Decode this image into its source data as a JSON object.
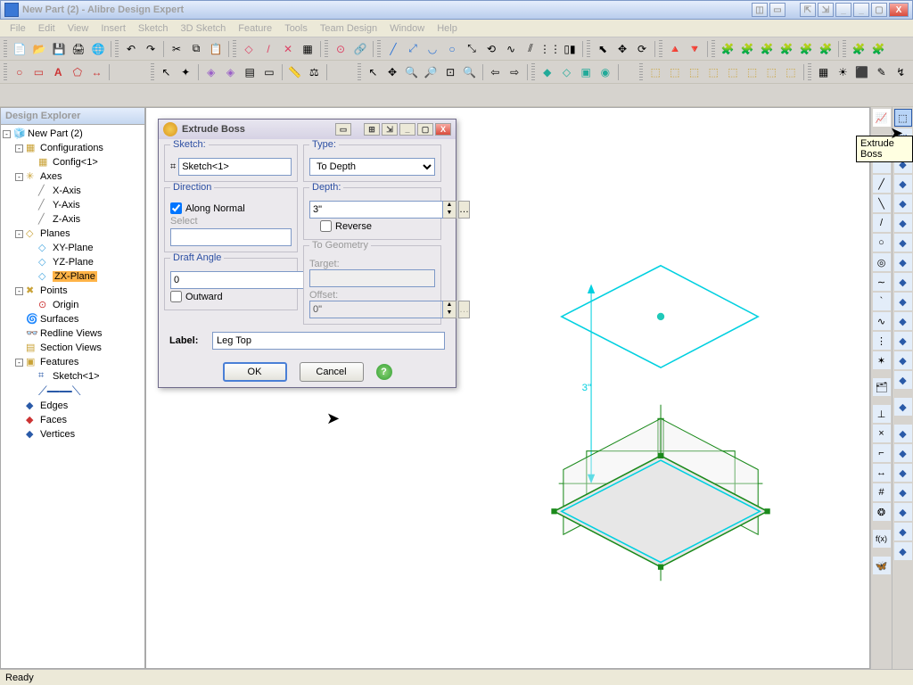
{
  "window": {
    "title": "New Part (2) - Alibre Design Expert"
  },
  "menu": [
    "File",
    "Edit",
    "View",
    "Insert",
    "Sketch",
    "3D Sketch",
    "Feature",
    "Tools",
    "Team Design",
    "Window",
    "Help"
  ],
  "explorer": {
    "title": "Design Explorer",
    "tree": [
      {
        "d": 0,
        "t": "-",
        "i": "part",
        "l": "New Part (2)"
      },
      {
        "d": 1,
        "t": "-",
        "i": "cfg",
        "l": "Configurations"
      },
      {
        "d": 2,
        "t": "",
        "i": "cfg",
        "l": "Config<1>"
      },
      {
        "d": 1,
        "t": "-",
        "i": "axes",
        "l": "Axes"
      },
      {
        "d": 2,
        "t": "",
        "i": "axis",
        "l": "X-Axis"
      },
      {
        "d": 2,
        "t": "",
        "i": "axis",
        "l": "Y-Axis"
      },
      {
        "d": 2,
        "t": "",
        "i": "axis",
        "l": "Z-Axis"
      },
      {
        "d": 1,
        "t": "-",
        "i": "planes",
        "l": "Planes"
      },
      {
        "d": 2,
        "t": "",
        "i": "plane",
        "l": "XY-Plane"
      },
      {
        "d": 2,
        "t": "",
        "i": "plane",
        "l": "YZ-Plane"
      },
      {
        "d": 2,
        "t": "",
        "i": "plane",
        "l": "ZX-Plane",
        "sel": true
      },
      {
        "d": 1,
        "t": "-",
        "i": "points",
        "l": "Points"
      },
      {
        "d": 2,
        "t": "",
        "i": "point",
        "l": "Origin"
      },
      {
        "d": 1,
        "t": "",
        "i": "surf",
        "l": "Surfaces"
      },
      {
        "d": 1,
        "t": "",
        "i": "rl",
        "l": "Redline Views"
      },
      {
        "d": 1,
        "t": "",
        "i": "sv",
        "l": "Section Views"
      },
      {
        "d": 1,
        "t": "-",
        "i": "feat",
        "l": "Features"
      },
      {
        "d": 2,
        "t": "",
        "i": "sketch",
        "l": "Sketch<1>"
      },
      {
        "d": 1,
        "t": "",
        "i": "edges",
        "l": "Edges"
      },
      {
        "d": 1,
        "t": "",
        "i": "faces",
        "l": "Faces"
      },
      {
        "d": 1,
        "t": "",
        "i": "verts",
        "l": "Vertices"
      }
    ]
  },
  "dialog": {
    "title": "Extrude Boss",
    "sketch_group": "Sketch:",
    "sketch_value": "Sketch<1>",
    "direction_group": "Direction",
    "along_normal": "Along Normal",
    "select_label": "Select",
    "draft_group": "Draft Angle",
    "draft_value": "0",
    "outward": "Outward",
    "type_group": "Type:",
    "type_value": "To Depth",
    "depth_group": "Depth:",
    "depth_value": "3\"",
    "reverse": "Reverse",
    "togeo_group": "To Geometry",
    "target_label": "Target:",
    "offset_label": "Offset:",
    "offset_value": "0\"",
    "label_label": "Label:",
    "label_value": "Leg Top",
    "ok": "OK",
    "cancel": "Cancel"
  },
  "viewport": {
    "dim": "3\""
  },
  "tooltip": "Extrude Boss",
  "status": "Ready"
}
